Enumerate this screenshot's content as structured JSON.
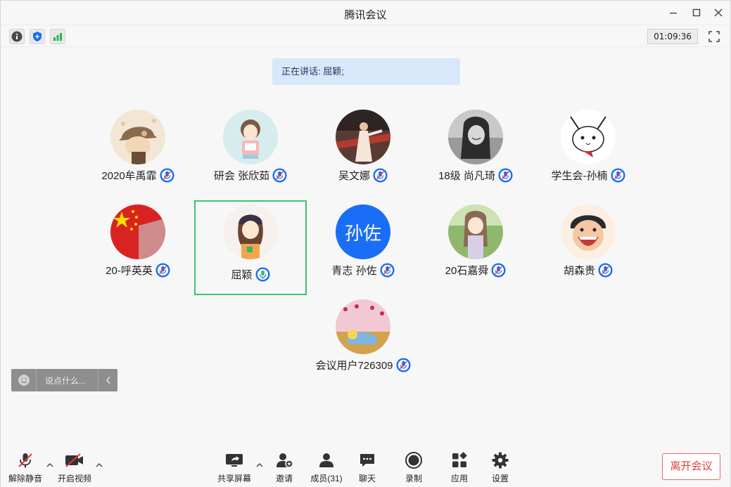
{
  "window": {
    "title": "腾讯会议"
  },
  "toolbar": {
    "timer": "01:09:36"
  },
  "speaking": {
    "text": "正在讲话: 屈颖;"
  },
  "participants": [
    {
      "name": "2020牟禹霏",
      "avatar": "hat-photo",
      "mic": "muted"
    },
    {
      "name": "研会 张欣茹",
      "avatar": "cartoon-girl",
      "mic": "muted"
    },
    {
      "name": "吴文娜",
      "avatar": "dancer-photo",
      "mic": "muted"
    },
    {
      "name": "18级 尚凡琦",
      "avatar": "bw-portrait",
      "mic": "muted"
    },
    {
      "name": "学生会-孙楠",
      "avatar": "pikachu-sketch",
      "mic": "muted"
    },
    {
      "name": "20-呼英英",
      "avatar": "china-flag",
      "mic": "muted"
    },
    {
      "name": "屈颖",
      "avatar": "beanie-girl",
      "mic": "speaking"
    },
    {
      "name": "青志 孙佐",
      "avatar_text": "孙佐",
      "mic": "muted"
    },
    {
      "name": "20石嘉舜",
      "avatar": "anime-girl",
      "mic": "muted"
    },
    {
      "name": "胡森贵",
      "avatar": "cartoon-laugh",
      "mic": "muted"
    },
    {
      "name": "会议用户726309",
      "avatar": "alice-doll",
      "mic": "muted"
    }
  ],
  "chat": {
    "placeholder": "说点什么..."
  },
  "bottom": {
    "unmute": "解除静音",
    "video": "开启视频",
    "share": "共享屏幕",
    "invite": "邀请",
    "members": "成员(31)",
    "chat": "聊天",
    "record": "录制",
    "apps": "应用",
    "settings": "设置",
    "leave": "离开会议"
  },
  "colors": {
    "accent": "#1a6ef5",
    "active_border": "#3cc46f",
    "leave": "#e23d3d",
    "speaking_bg": "#d8e7fa"
  }
}
